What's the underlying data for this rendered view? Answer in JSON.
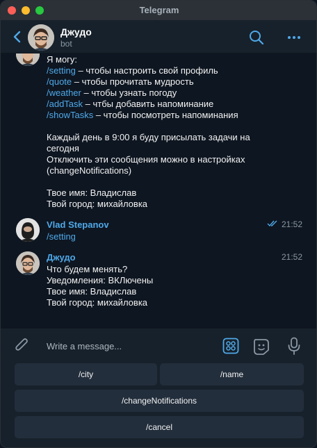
{
  "window": {
    "title": "Telegram"
  },
  "header": {
    "name": "Джудо",
    "status": "bot"
  },
  "messages": {
    "bot_intro_lines": [
      {
        "cmd": "",
        "text": "Я могу:"
      },
      {
        "cmd": "/setting",
        "text": " – чтобы настроить свой профиль"
      },
      {
        "cmd": "/quote",
        "text": " – чтобы прочитать мудрость"
      },
      {
        "cmd": "/weather",
        "text": " – чтобы узнать погоду"
      },
      {
        "cmd": "/addTask",
        "text": " – чтбы добавить напоминание"
      },
      {
        "cmd": "/showTasks",
        "text": " – чтобы посмотреть напоминания"
      }
    ],
    "schedule_line1": "Каждый день в 9:00 я буду присылать задачи на",
    "schedule_line2": "сегодня",
    "disable_line1": "Отключить эти сообщения можно в настройках",
    "disable_line2": "(changeNotifications)",
    "name_line": "Твое имя: Владислав",
    "city_line": "Твой город: михайловка",
    "user_msg": {
      "sender": "Vlad Stepanov",
      "time": "21:52",
      "text": "/setting"
    },
    "bot_reply": {
      "sender": "Джудо",
      "time": "21:52",
      "lines": [
        "Что будем менять?",
        "Уведомления:  ВКЛючены",
        "Твое имя: Владислав",
        "Твой город: михайловка"
      ]
    }
  },
  "composer": {
    "placeholder": "Write a message..."
  },
  "keyboard": {
    "city": "/city",
    "name": "/name",
    "change_notifications": "/changeNotifications",
    "cancel": "/cancel"
  },
  "colors": {
    "accent": "#4fa9e9",
    "background": "#0e1621",
    "panel": "#17212b",
    "button": "#232e3c"
  },
  "icons": [
    "back-icon",
    "search-icon",
    "more-icon",
    "double-check-icon",
    "attach-icon",
    "bot-keyboard-icon",
    "sticker-icon",
    "microphone-icon"
  ]
}
